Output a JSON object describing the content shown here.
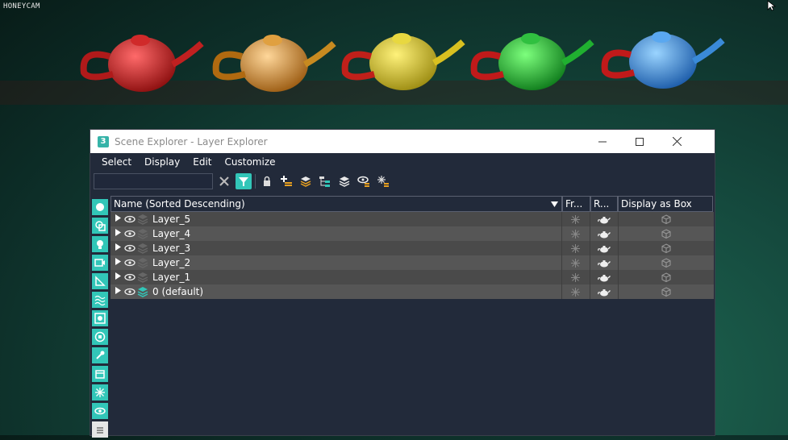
{
  "watermark": "HONEYCAM",
  "window": {
    "title": "Scene Explorer - Layer Explorer",
    "app_icon": "3"
  },
  "menu": [
    "Select",
    "Display",
    "Edit",
    "Customize"
  ],
  "toolbar": {
    "search_value": "",
    "icons": [
      "clear-icon",
      "filter-icon",
      "lock-icon",
      "add-layer-icon",
      "layers-icon",
      "hierarchy-icon",
      "stack-icon",
      "hide-icon",
      "freeze-icon"
    ]
  },
  "sidebar_icons": [
    "sphere-icon",
    "shape-icon",
    "light-icon",
    "camera-icon",
    "helper-icon",
    "spacewarp-icon",
    "group-icon",
    "xref-icon",
    "bone-icon",
    "container-icon",
    "freeze-icon",
    "eye-icon",
    "more-icon"
  ],
  "columns": {
    "name": "Name (Sorted Descending)",
    "freeze": "Fr...",
    "render": "R...",
    "display_box": "Display as Box"
  },
  "rows": [
    {
      "name": "Layer_5"
    },
    {
      "name": "Layer_4"
    },
    {
      "name": "Layer_3"
    },
    {
      "name": "Layer_2"
    },
    {
      "name": "Layer_1"
    },
    {
      "name": "0 (default)",
      "active": true
    }
  ],
  "colors": {
    "accent": "#32c6b8",
    "panel": "#222a3a",
    "row_odd": "#4a4a4a",
    "row_even": "#565656"
  }
}
